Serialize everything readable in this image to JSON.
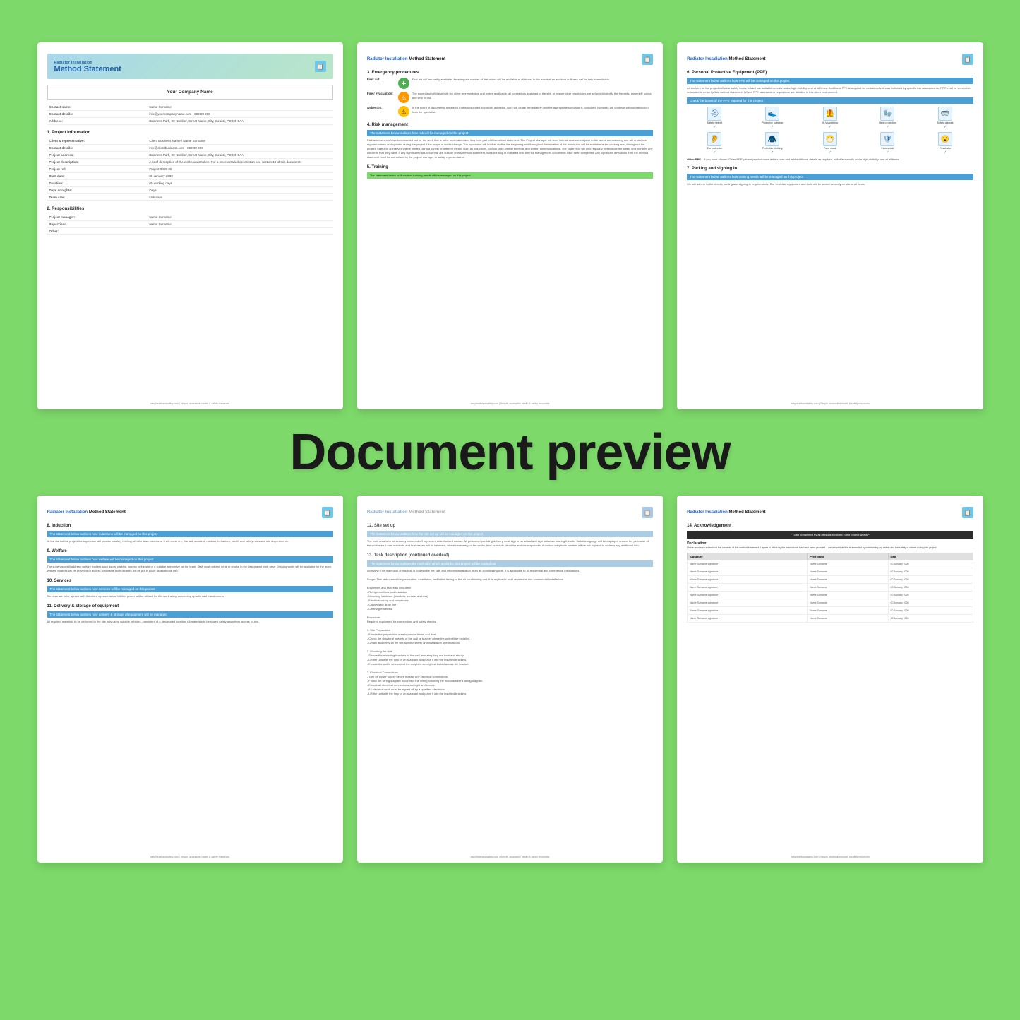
{
  "page": {
    "background": "#7dd96a",
    "preview_label": "Document preview"
  },
  "pages": [
    {
      "id": "page1",
      "header": {
        "subtitle": "Radiator Installation",
        "title": "Method Statement"
      },
      "company_name": "Your Company Name",
      "contact_rows": [
        {
          "label": "Contact name:",
          "value": "Name Surname"
        },
        {
          "label": "Contact details:",
          "value": "info@yourcompanyname.com  +000 00 000"
        },
        {
          "label": "Address:",
          "value": "Business Park, 00 Number, Street Name, City, County, PO000 0AA"
        }
      ],
      "sections": [
        {
          "title": "1. Project information",
          "rows": [
            {
              "label": "Client & representative:",
              "value": "Client Business Name  /  Name Surname"
            },
            {
              "label": "Contact details:",
              "value": "info@clientbusiness.com  +000 00 000"
            },
            {
              "label": "Project address:",
              "value": "Business Park, 00 Number, Street Name, City, County, PO000 0AA"
            },
            {
              "label": "Project description:",
              "value": "A brief description of the works undertaken. For a more detailed description see section 13 of this document."
            },
            {
              "label": "Project ref:",
              "value": "Project-0000-00"
            },
            {
              "label": "Start date:",
              "value": "00 January 2000"
            },
            {
              "label": "Duration:",
              "value": "00 working days"
            },
            {
              "label": "Days or nights:",
              "value": "Days"
            },
            {
              "label": "Team size:",
              "value": "Unknown"
            }
          ]
        },
        {
          "title": "2. Responsibilities",
          "rows": [
            {
              "label": "Project manager:",
              "value": "Name Surname"
            },
            {
              "label": "Supervisor:",
              "value": "Name Surname"
            },
            {
              "label": "Other:",
              "value": ""
            }
          ]
        }
      ],
      "footer": "easyhealthandsafety.com  |  Simple, accessible health & safety resources"
    },
    {
      "id": "page2",
      "doc_title": "Radiator Installation Method Statement",
      "sections": [
        {
          "number": "3.",
          "title": "Emergency procedures",
          "items": [
            {
              "label": "First aid:",
              "icon": "plus",
              "color": "green",
              "text": "First aid will be readily available. An adequate number of first aiders will be available at all times. In the event of an accident or illness call for help immediately."
            },
            {
              "label": "Fire / evacuation:",
              "icon": "flame",
              "color": "orange",
              "text": "The supervisor will liaise with the client representative and where applicable, all contractors assigned to the site, to ensure clear procedures are set which identify the fire exits, assembly points and who to call."
            },
            {
              "label": "Asbestos:",
              "icon": "warning",
              "color": "yellow",
              "text": "In the event of discovering a material that is suspected to contain asbestos, work will cease immediately until the appropriate specialist is consulted. No works will continue without instruction from the specialist."
            }
          ]
        },
        {
          "number": "4.",
          "title": "Risk management",
          "blue_bar": "The statement below outlines how risk will be managed on this project",
          "text": "Risk assessments have been carried out for the work that is to be undertaken and they form part of this method statement. The Project Manager will read the risk assessment prior to the works commencing and will undertake regular reviews and updates during the project if the scope of works change. The supervisor will brief all staff at the beginning and throughout the duration of the works and will be available at the working area throughout the project. Staff and operatives will be briefed using a variety of different means such as inductions, toolbox talks, verbal briefings and written communications. The supervisor will also regularly redistribute the safety and highlight any concerns that they have. If any significant risks occur that are outside of this method statement, work will stop in that area until the risk management documents have been completed. Any significant deviations from the method statement must be authorised by the project manager or safety representative."
        },
        {
          "number": "5.",
          "title": "Training",
          "green_bar": "The statement below outlines how training needs will be managed on this project",
          "text": ""
        }
      ],
      "footer": "easyhealthandsafety.com  |  Simple, accessible health & safety resources"
    },
    {
      "id": "page3",
      "doc_title": "Radiator Installation Method Statement",
      "sections": [
        {
          "number": "6.",
          "title": "Personal Protective Equipment (PPE)",
          "blue_bar": "The statement below outlines how PPE will be managed on this project",
          "intro_text": "All workers on the project will wear safety boots, a hard hat, suitable overalls and a high-visibility vest at all times. Additional PPE is required for certain activities as indicated by specific risk assessments. PPE must be worn when instructed to do so by this method statement. Where PPE standards or regulations are detailed in this client environment.",
          "check_bar": "Check the boxes of the PPE required for this project",
          "ppe_items_row1": [
            {
              "icon": "⛑",
              "label": "Safety helmet",
              "checked": true
            },
            {
              "icon": "👟",
              "label": "Protective footwear",
              "checked": true
            },
            {
              "icon": "🦺",
              "label": "Hi-Vis clothing",
              "checked": true
            },
            {
              "icon": "🧤",
              "label": "Hand protection",
              "checked": true
            },
            {
              "icon": "🥽",
              "label": "Safety glasses",
              "checked": true
            }
          ],
          "ppe_items_row2": [
            {
              "icon": "🦻",
              "label": "Ear protection",
              "checked": true
            },
            {
              "icon": "🧥",
              "label": "Protective clothing",
              "checked": true
            },
            {
              "icon": "😷",
              "label": "Face mask",
              "checked": true
            },
            {
              "icon": "🛡",
              "label": "Face shield",
              "checked": true
            },
            {
              "icon": "😮‍💨",
              "label": "Respirator",
              "checked": true
            }
          ],
          "ppe_other_checked": true,
          "ppe_other_text": "If you have chosen 'Other PPE' please provide more details here and add additional details as required, suitable overalls and a high-visibility vest at all times"
        },
        {
          "number": "7.",
          "title": "Parking and signing in",
          "blue_bar": "The statement below outlines how training needs will be managed on this project",
          "text": "We will adhere to the client's parking and signing-in requirements. Our vehicles, equipment and tools will be stored securely on site at all times."
        }
      ],
      "footer": "easyhealthandsafety.com  |  Simple, accessible health & safety resources"
    },
    {
      "id": "page4",
      "doc_title": "Radiator Installation Method Statement",
      "sections": [
        {
          "number": "8.",
          "title": "Induction",
          "blue_bar": "The statement below outlines how inductions will be managed on this project",
          "text": "At the start of the project the supervisor will provide a safety briefing with the team members. It will cover fire, first aid, accident, medical, behaviour, health and safety rules and site requirements."
        },
        {
          "number": "9.",
          "title": "Welfare",
          "blue_bar": "The statement below outlines how welfare will be managed on this project",
          "text": "The supervisor will address welfare matters such as car parking, access to the site or a suitable alternative for the team. Staff must not eat, drink or smoke in the designated work area. Drinking water will be available for the team. Welfare facilities will be provided or access to suitable toilet facilities will be put in place as additional info."
        },
        {
          "number": "10.",
          "title": "Services",
          "blue_bar": "The statement below outlines how services will be managed on this project",
          "text": "Services are to be agreed with the client representative. Utilities power will be utilised for this work along connecting up with said transformers."
        },
        {
          "number": "11.",
          "title": "Delivery & storage of equipment",
          "blue_bar": "The statement below outlines how delivery & storage of equipment will be managed",
          "text": "All required materials to be delivered to the site only using suitable vehicles, consistent of a designated location. All materials to be stored safely away from access routes."
        }
      ],
      "footer": "easyhealthandsafety.com  |  Simple, accessible health & safety resources"
    },
    {
      "id": "page5",
      "doc_title": "Radiator Installation Method Statement",
      "sections": [
        {
          "number": "12.",
          "title": "Site set up",
          "blue_bar": "The statement below outlines how the site set up will be managed on this project",
          "text": "The work area is to be securely cordoned off to prevent unauthorised access. All personnel providing delivery must sign in on arrival and sign out when leaving the site. Suitable signage will be displayed around the perimeter of the work area. Local residents and businesses will be informed, where necessary, of the works, time schedule, deadline and consequences. A contact telephone number will be put in place to address any additional info."
        },
        {
          "number": "13.",
          "title": "Task description (continued overleaf)",
          "blue_bar": "The statement below outlines the method in which works for this project will be carried out",
          "text": "Overview: The main goal of this task is to describe the safe and efficient installation of an air conditioning unit. It is applicable to all residential and commercial installations.\n\nScope: This task covers the preparation, installation, and initial testing of the air conditioning unit. It is applicable to all residential and commercial installations.\n\nEquipment and Materials Required:\n- Refrigerant lines and insulation\n- Mounting hardware (brackets, screws, anchors)\n- Electrical wiring and connectors\n- Condensate drain line\n- Cleaning materials\n\nProcedure:\nRequired equipment for connections and safety checks.\n\n1. Site Preparation\n- Ensure the preparation area is clear of items and dust.\n- Check the structural integrity of the wall or bracket where the unit will be installed.\n- Obtain and verify all the site-specific safety and installation specifications.\n\n2. Mounting the Unit\n- Secure the mounting brackets to the wall, ensuring they are level and sturdy.\n- Lift the unit with the help of an assistant and place it into the installed brackets.\n- Ensure the unit is secure and the weight is evenly distributed across the bracket.\n\n3. Electrical Connections\n- Turn off power supply before making any electrical connections.\n- Follow the wiring diagram to connect the wiring following the manufacturer's wiring diagram.\n- Ensure all electrical connections are tight and secure.\n- All electrical work must be signed off by a qualified electrician.\n- Lift the unit with the help of an assistant and place it into the installed brackets."
        }
      ],
      "footer": "easyhealthandsafety.com  |  Simple, accessible health & safety resources"
    },
    {
      "id": "page6",
      "doc_title": "Radiator Installation Method Statement",
      "sections": [
        {
          "number": "14.",
          "title": "Acknowledgement",
          "dark_bar": "* To be completed by all persons involved in the project works *",
          "declaration_title": "Declaration:",
          "declaration_text": "I have read and understood the contents of this method statement. I agree to abide by the instructions that have been provided. I am aware that this is amended by maintaining my safety and the safety of others during this project.",
          "sig_headers": [
            "Signature",
            "Print name",
            "Date"
          ],
          "signatures": [
            {
              "sig": "Name Surname signature",
              "name": "Name Surname",
              "date": "00 January 2000"
            },
            {
              "sig": "Name Surname signature",
              "name": "Name Surname",
              "date": "00 January 2000"
            },
            {
              "sig": "Name Surname signature",
              "name": "Name Surname",
              "date": "00 January 2000"
            },
            {
              "sig": "Name Surname signature",
              "name": "Name Surname",
              "date": "00 January 2000"
            },
            {
              "sig": "Name Surname signature",
              "name": "Name Surname",
              "date": "00 January 2000"
            },
            {
              "sig": "Name Surname signature",
              "name": "Name Surname",
              "date": "00 January 2000"
            },
            {
              "sig": "Name Surname signature",
              "name": "Name Surname",
              "date": "00 January 2000"
            },
            {
              "sig": "Name Surname signature",
              "name": "Name Surname",
              "date": "00 January 2000"
            }
          ]
        }
      ],
      "footer": "easyhealthandsafety.com  |  Simple, accessible health & safety resources"
    }
  ],
  "preview_label": "Document preview",
  "footer_text": "easyhealthandsafety.com  |  Simple, accessible health & safety resources"
}
